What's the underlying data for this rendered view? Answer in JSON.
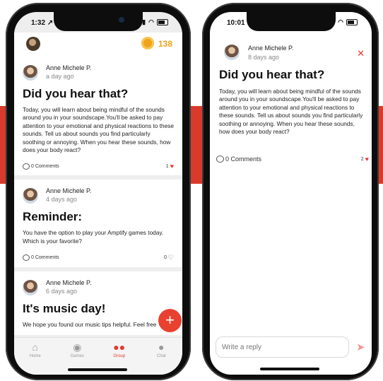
{
  "colors": {
    "accent": "#e3392b",
    "coin": "#f0a21a",
    "band": "#d93a2b"
  },
  "left_phone": {
    "status_time": "1:32 ↗",
    "coin_count": "138",
    "posts": [
      {
        "author": "Anne Michele P.",
        "ago": "a day ago",
        "title": "Did you hear that?",
        "body": "Today, you will learn about being mindful of the sounds around you in your soundscape.You'll be asked to pay attention to your emotional and physical reactions to these sounds. Tell us about sounds you find particularly soothing or annoying. When you hear these sounds, how does your body react?",
        "comments": "0 Comments",
        "likes": "1",
        "liked": true
      },
      {
        "author": "Anne Michele P.",
        "ago": "4 days ago",
        "title": "Reminder:",
        "body": "You have the option to play your Amptify games today. Which is your favorite?",
        "comments": "0 Comments",
        "likes": "0",
        "liked": false
      },
      {
        "author": "Anne Michele P.",
        "ago": "6 days ago",
        "title": "It's music day!",
        "body": "We hope you found our music tips helpful. Feel free",
        "comments": "",
        "likes": "",
        "liked": false
      }
    ],
    "fab_icon": "plus-icon",
    "tabs": [
      {
        "label": "Home",
        "icon": "home-icon",
        "active": false
      },
      {
        "label": "Games",
        "icon": "gamepad-icon",
        "active": false
      },
      {
        "label": "Group",
        "icon": "group-icon",
        "active": true
      },
      {
        "label": "Chat",
        "icon": "chat-icon",
        "active": false
      }
    ]
  },
  "right_phone": {
    "status_time": "10:01 ↗",
    "author": "Anne Michele P.",
    "ago": "8 days ago",
    "title": "Did you hear that?",
    "body": "Today, you will learn about being mindful of the sounds around you in your soundscape.You'll be asked to pay attention to your emotional and physical reactions to these sounds. Tell us about sounds you find particularly soothing or annoying. When you hear these sounds, how does your body react?",
    "comments": "0 Comments",
    "likes": "2",
    "reply_placeholder": "Write a reply"
  }
}
